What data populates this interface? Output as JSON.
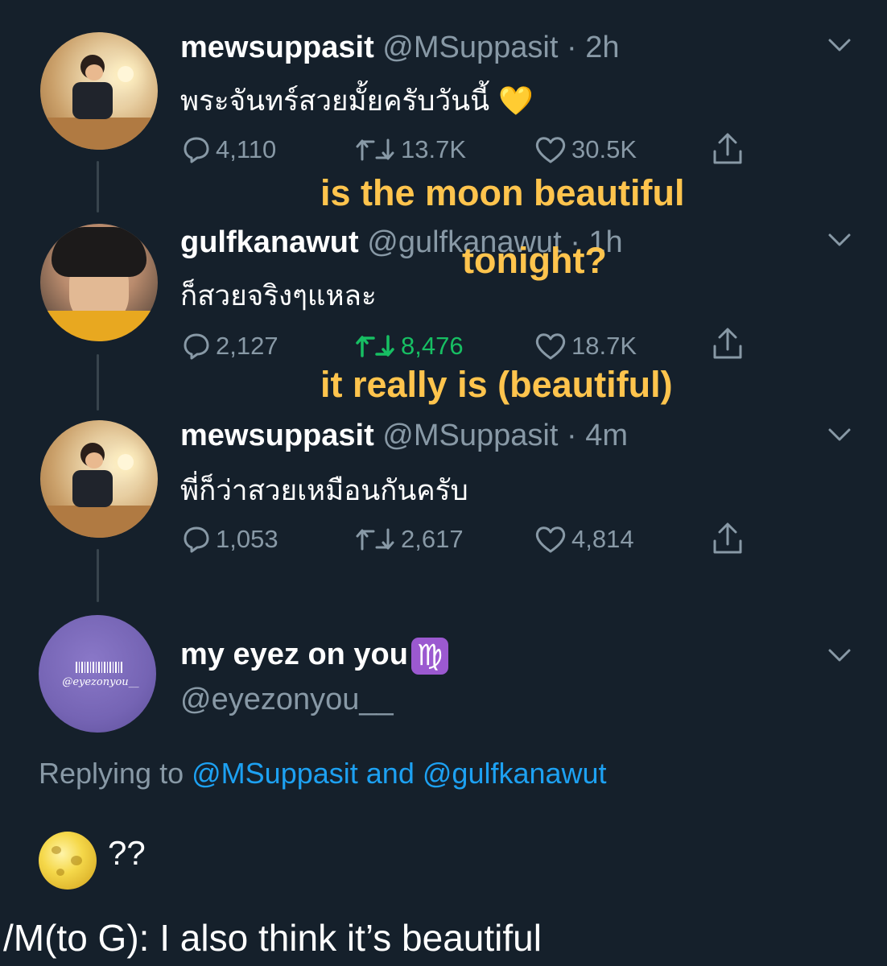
{
  "tweets": [
    {
      "name": "mewsuppasit",
      "handle": "@MSuppasit",
      "time": "· 2h",
      "text": "พระจันทร์สวยมั้ยครับวันนี้",
      "emoji": "💛",
      "replies": "4,110",
      "retweets": "13.7K",
      "likes": "30.5K"
    },
    {
      "name": "gulfkanawut",
      "handle": "@gulfkanawut",
      "time": "· 1h",
      "text": "ก็สวยจริงๆแหละ",
      "replies": "2,127",
      "retweets": "8,476",
      "likes": "18.7K"
    },
    {
      "name": "mewsuppasit",
      "handle": "@MSuppasit",
      "time": "· 4m",
      "text": "พี่ก็ว่าสวยเหมือนกันครับ",
      "replies": "1,053",
      "retweets": "2,617",
      "likes": "4,814"
    }
  ],
  "main_tweet": {
    "name": "my eyez on you",
    "zodiac": "♍",
    "handle": "@eyezonyou__",
    "avatar_signature": "@eyezonyou__",
    "replying_prefix": "Replying to",
    "replying_to_1": "@MSuppasit",
    "replying_and": "and",
    "replying_to_2": "@gulfkanawut",
    "text": "??",
    "emoji": "moon-icon"
  },
  "overlays": {
    "line1": "is the moon beautiful",
    "line2": "tonight?",
    "line3": "it really is (beautiful)"
  },
  "caption": "/M(to G): I also think it’s beautiful",
  "colors": {
    "background": "#15202b",
    "muted": "#8899a6",
    "link": "#1da1f2",
    "retweet_active": "#17bf63",
    "overlay_text": "#ffc44d"
  }
}
